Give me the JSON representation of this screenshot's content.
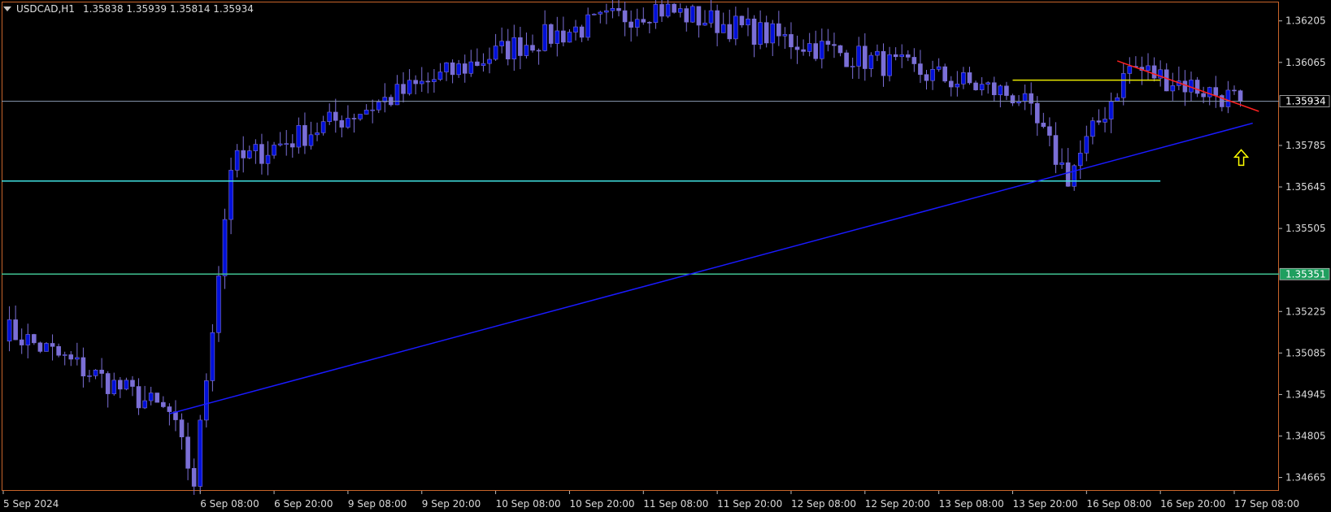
{
  "header": {
    "symbol_tf": "USDCAD,H1",
    "quotes": "1.35838 1.35939 1.35814 1.35934"
  },
  "colors": {
    "background": "#000000",
    "frame": "#c8642a",
    "axis_text": "#d9d9d9",
    "candle": "#7b6fd6",
    "candle_bull_body": "#0010d8",
    "current_price_line": "#8c9cb4",
    "support_cyan": "#40e0e0",
    "support_green": "#40c090",
    "trend_blue": "#1a1aff",
    "trend_red": "#ff2020",
    "resistance_yellow": "#e8e800",
    "arrow_yellow": "#ffff00",
    "price_tag_green_bg": "#1f9f5f"
  },
  "chart_data": {
    "type": "candlestick",
    "symbol": "USDCAD",
    "timeframe": "H1",
    "y_ticks": [
      "1.36205",
      "1.36065",
      "1.35934",
      "1.35785",
      "1.35645",
      "1.35505",
      "1.35351",
      "1.35225",
      "1.35085",
      "1.34945",
      "1.34805",
      "1.34665"
    ],
    "y_range": [
      1.3462,
      1.3627
    ],
    "x_ticks": [
      "5 Sep 2024",
      "6 Sep 08:00",
      "6 Sep 20:00",
      "9 Sep 08:00",
      "9 Sep 20:00",
      "10 Sep 08:00",
      "10 Sep 20:00",
      "11 Sep 08:00",
      "11 Sep 20:00",
      "12 Sep 08:00",
      "12 Sep 20:00",
      "13 Sep 08:00",
      "13 Sep 20:00",
      "16 Sep 08:00",
      "16 Sep 20:00",
      "17 Sep 08:00"
    ],
    "current_price": 1.35934,
    "current_price_label": "1.35934",
    "green_level": 1.35351,
    "green_level_label": "1.35351",
    "cyan_level": 1.35665,
    "yellow_level": 1.36005,
    "key_points": [
      {
        "t": "6 Sep 03:00",
        "price": 1.3488
      },
      {
        "t": "6 Sep 07:00",
        "price": 1.3465
      },
      {
        "t": "6 Sep 13:00",
        "price": 1.3572
      },
      {
        "t": "10 Sep 11:00",
        "price": 1.3612
      },
      {
        "t": "11 Sep 10:00",
        "price": 1.3625
      },
      {
        "t": "13 Sep 21:00",
        "price": 1.3595
      },
      {
        "t": "16 Sep 05:00",
        "price": 1.3568
      },
      {
        "t": "16 Sep 15:00",
        "price": 1.3605
      },
      {
        "t": "17 Sep 09:00",
        "price": 1.35934
      }
    ]
  }
}
